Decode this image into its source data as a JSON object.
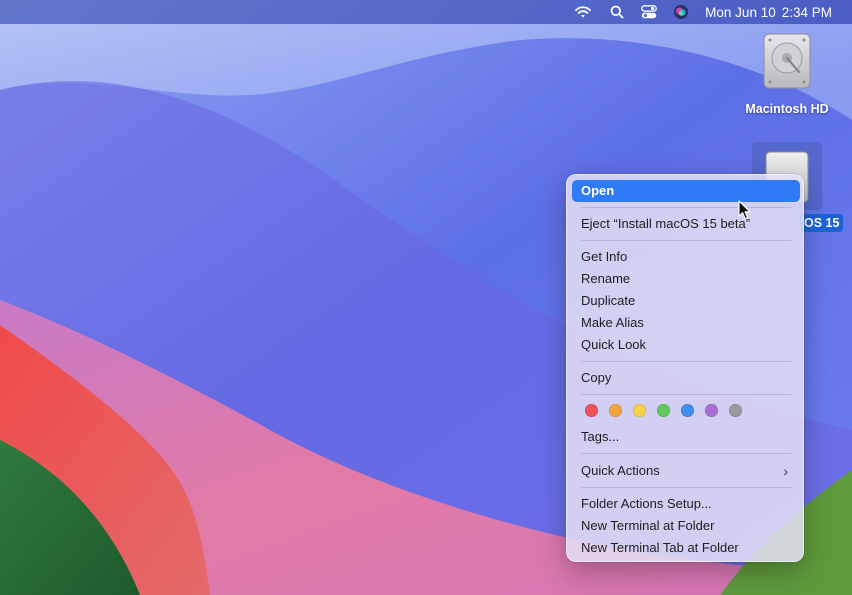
{
  "menubar": {
    "date": "Mon Jun 10",
    "time": "2:34 PM",
    "icons": [
      "wifi-icon",
      "search-icon",
      "control-center-icon",
      "siri-icon"
    ]
  },
  "desktop": {
    "icon1_label": "Macintosh HD",
    "icon2_label_visible": "OS 15"
  },
  "context_menu": {
    "items": [
      {
        "label": "Open"
      },
      {
        "label": "Eject “Install macOS 15 beta”"
      },
      {
        "label": "Get Info"
      },
      {
        "label": "Rename"
      },
      {
        "label": "Duplicate"
      },
      {
        "label": "Make Alias"
      },
      {
        "label": "Quick Look"
      },
      {
        "label": "Copy"
      },
      {
        "label": "Tags..."
      },
      {
        "label": "Quick Actions"
      },
      {
        "label": "Folder Actions Setup..."
      },
      {
        "label": "New Terminal at Folder"
      },
      {
        "label": "New Terminal Tab at Folder"
      }
    ],
    "tag_colors": [
      "#ec5354",
      "#f2a33c",
      "#f5d248",
      "#5fc95b",
      "#3d8ff0",
      "#ab6ed6",
      "#9a9a9e"
    ]
  },
  "colors": {
    "selection_accent": "#2f7bf5",
    "icon_label_selected": "#1c64d6"
  }
}
